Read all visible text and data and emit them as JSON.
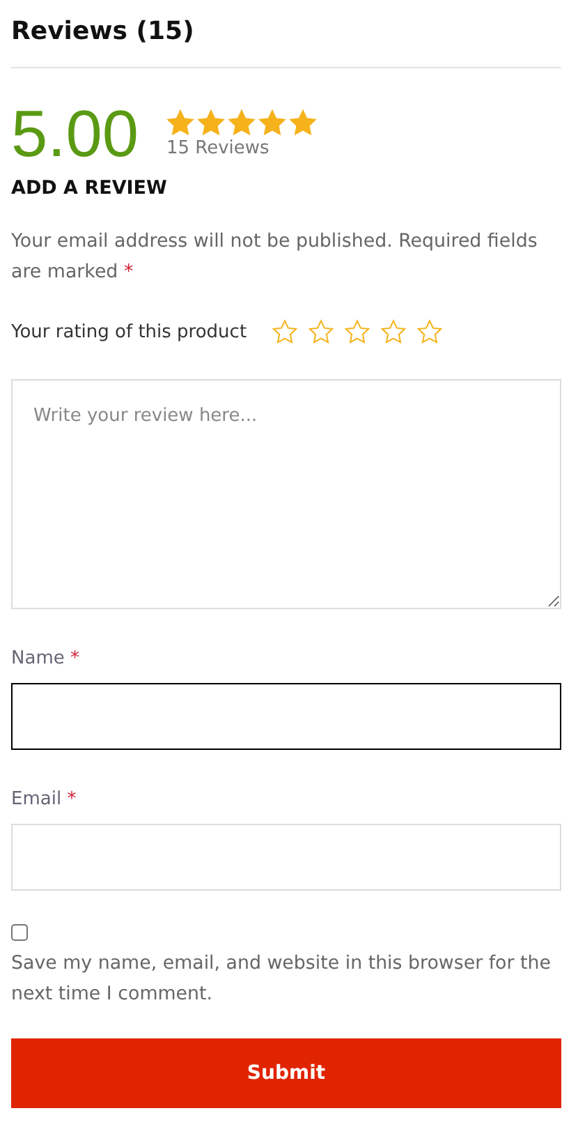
{
  "heading": "Reviews (15)",
  "summary": {
    "score": "5.00",
    "stars": 5,
    "count": "15 Reviews"
  },
  "form": {
    "title": "ADD A REVIEW",
    "notice": "Your email address will not be published. Required fields are marked",
    "notice_mark": "*",
    "rating": {
      "label": "Your rating of this product",
      "stars": 0
    },
    "review": {
      "placeholder": "Write your review here..."
    },
    "fields": [
      {
        "label": "Name",
        "required": true,
        "mark": "*",
        "focused": true
      },
      {
        "label": "Email",
        "required": true,
        "mark": "*",
        "focused": false
      }
    ],
    "consent": {
      "checked": false,
      "text": "Save my name, email, and website in this browser for the next time I comment."
    },
    "submit": "Submit"
  }
}
